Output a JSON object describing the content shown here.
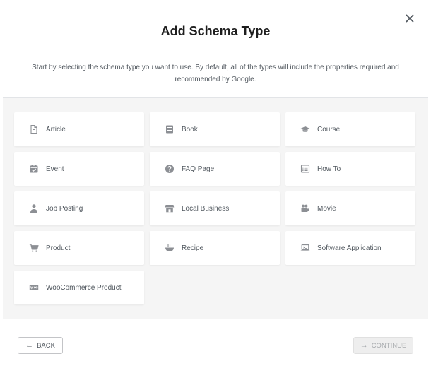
{
  "modal": {
    "title": "Add Schema Type",
    "subtitle": "Start by selecting the schema type you want to use. By default, all of the types will include the properties required and recommended by Google.",
    "close_icon": "close-icon"
  },
  "schema_types": [
    {
      "label": "Article",
      "icon": "document-icon"
    },
    {
      "label": "Book",
      "icon": "book-icon"
    },
    {
      "label": "Course",
      "icon": "graduation-cap-icon"
    },
    {
      "label": "Event",
      "icon": "calendar-check-icon"
    },
    {
      "label": "FAQ Page",
      "icon": "question-circle-icon"
    },
    {
      "label": "How To",
      "icon": "list-icon"
    },
    {
      "label": "Job Posting",
      "icon": "person-icon"
    },
    {
      "label": "Local Business",
      "icon": "store-icon"
    },
    {
      "label": "Movie",
      "icon": "video-camera-icon"
    },
    {
      "label": "Product",
      "icon": "cart-icon"
    },
    {
      "label": "Recipe",
      "icon": "bowl-icon"
    },
    {
      "label": "Software Application",
      "icon": "laptop-icon"
    },
    {
      "label": "WooCommerce Product",
      "icon": "woo-icon"
    }
  ],
  "footer": {
    "back_label": "BACK",
    "continue_label": "CONTINUE",
    "continue_disabled": true
  },
  "colors": {
    "icon": "#8c8f94",
    "panel_bg": "#f5f5f5",
    "card_bg": "#ffffff"
  }
}
